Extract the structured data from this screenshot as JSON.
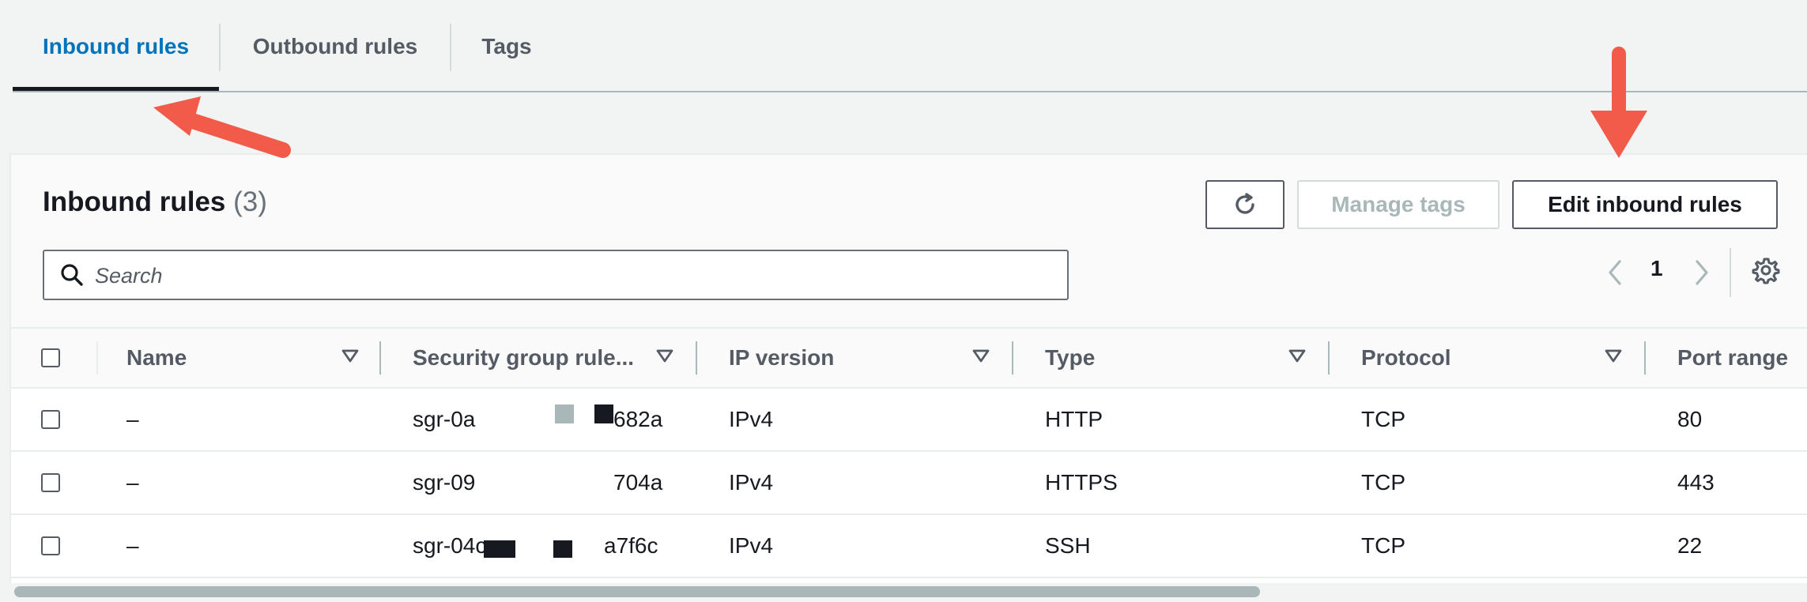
{
  "tabs": [
    {
      "label": "Inbound rules",
      "active": true
    },
    {
      "label": "Outbound rules",
      "active": false
    },
    {
      "label": "Tags",
      "active": false
    }
  ],
  "panel": {
    "title": "Inbound rules",
    "count": "(3)",
    "buttons": {
      "refresh_icon": "refresh-icon",
      "manage_tags": "Manage tags",
      "edit_inbound_rules": "Edit inbound rules"
    },
    "search": {
      "placeholder": "Search",
      "value": ""
    },
    "pagination": {
      "current_page": "1"
    }
  },
  "table": {
    "columns": [
      "Name",
      "Security group rule...",
      "IP version",
      "Type",
      "Protocol",
      "Port range"
    ],
    "rows": [
      {
        "name": "–",
        "rule_prefix": "sgr-0a",
        "rule_suffix": "682a",
        "ip_version": "IPv4",
        "type": "HTTP",
        "protocol": "TCP",
        "port_range": "80"
      },
      {
        "name": "–",
        "rule_prefix": "sgr-09",
        "rule_suffix": "704a",
        "ip_version": "IPv4",
        "type": "HTTPS",
        "protocol": "TCP",
        "port_range": "443"
      },
      {
        "name": "–",
        "rule_prefix": "sgr-04c",
        "rule_suffix": "a7f6c",
        "ip_version": "IPv4",
        "type": "SSH",
        "protocol": "TCP",
        "port_range": "22"
      }
    ]
  },
  "colors": {
    "accent_blue": "#0073bb",
    "annotation_red": "#f25a4a",
    "text_dark": "#16191f",
    "text_muted": "#545b64"
  }
}
